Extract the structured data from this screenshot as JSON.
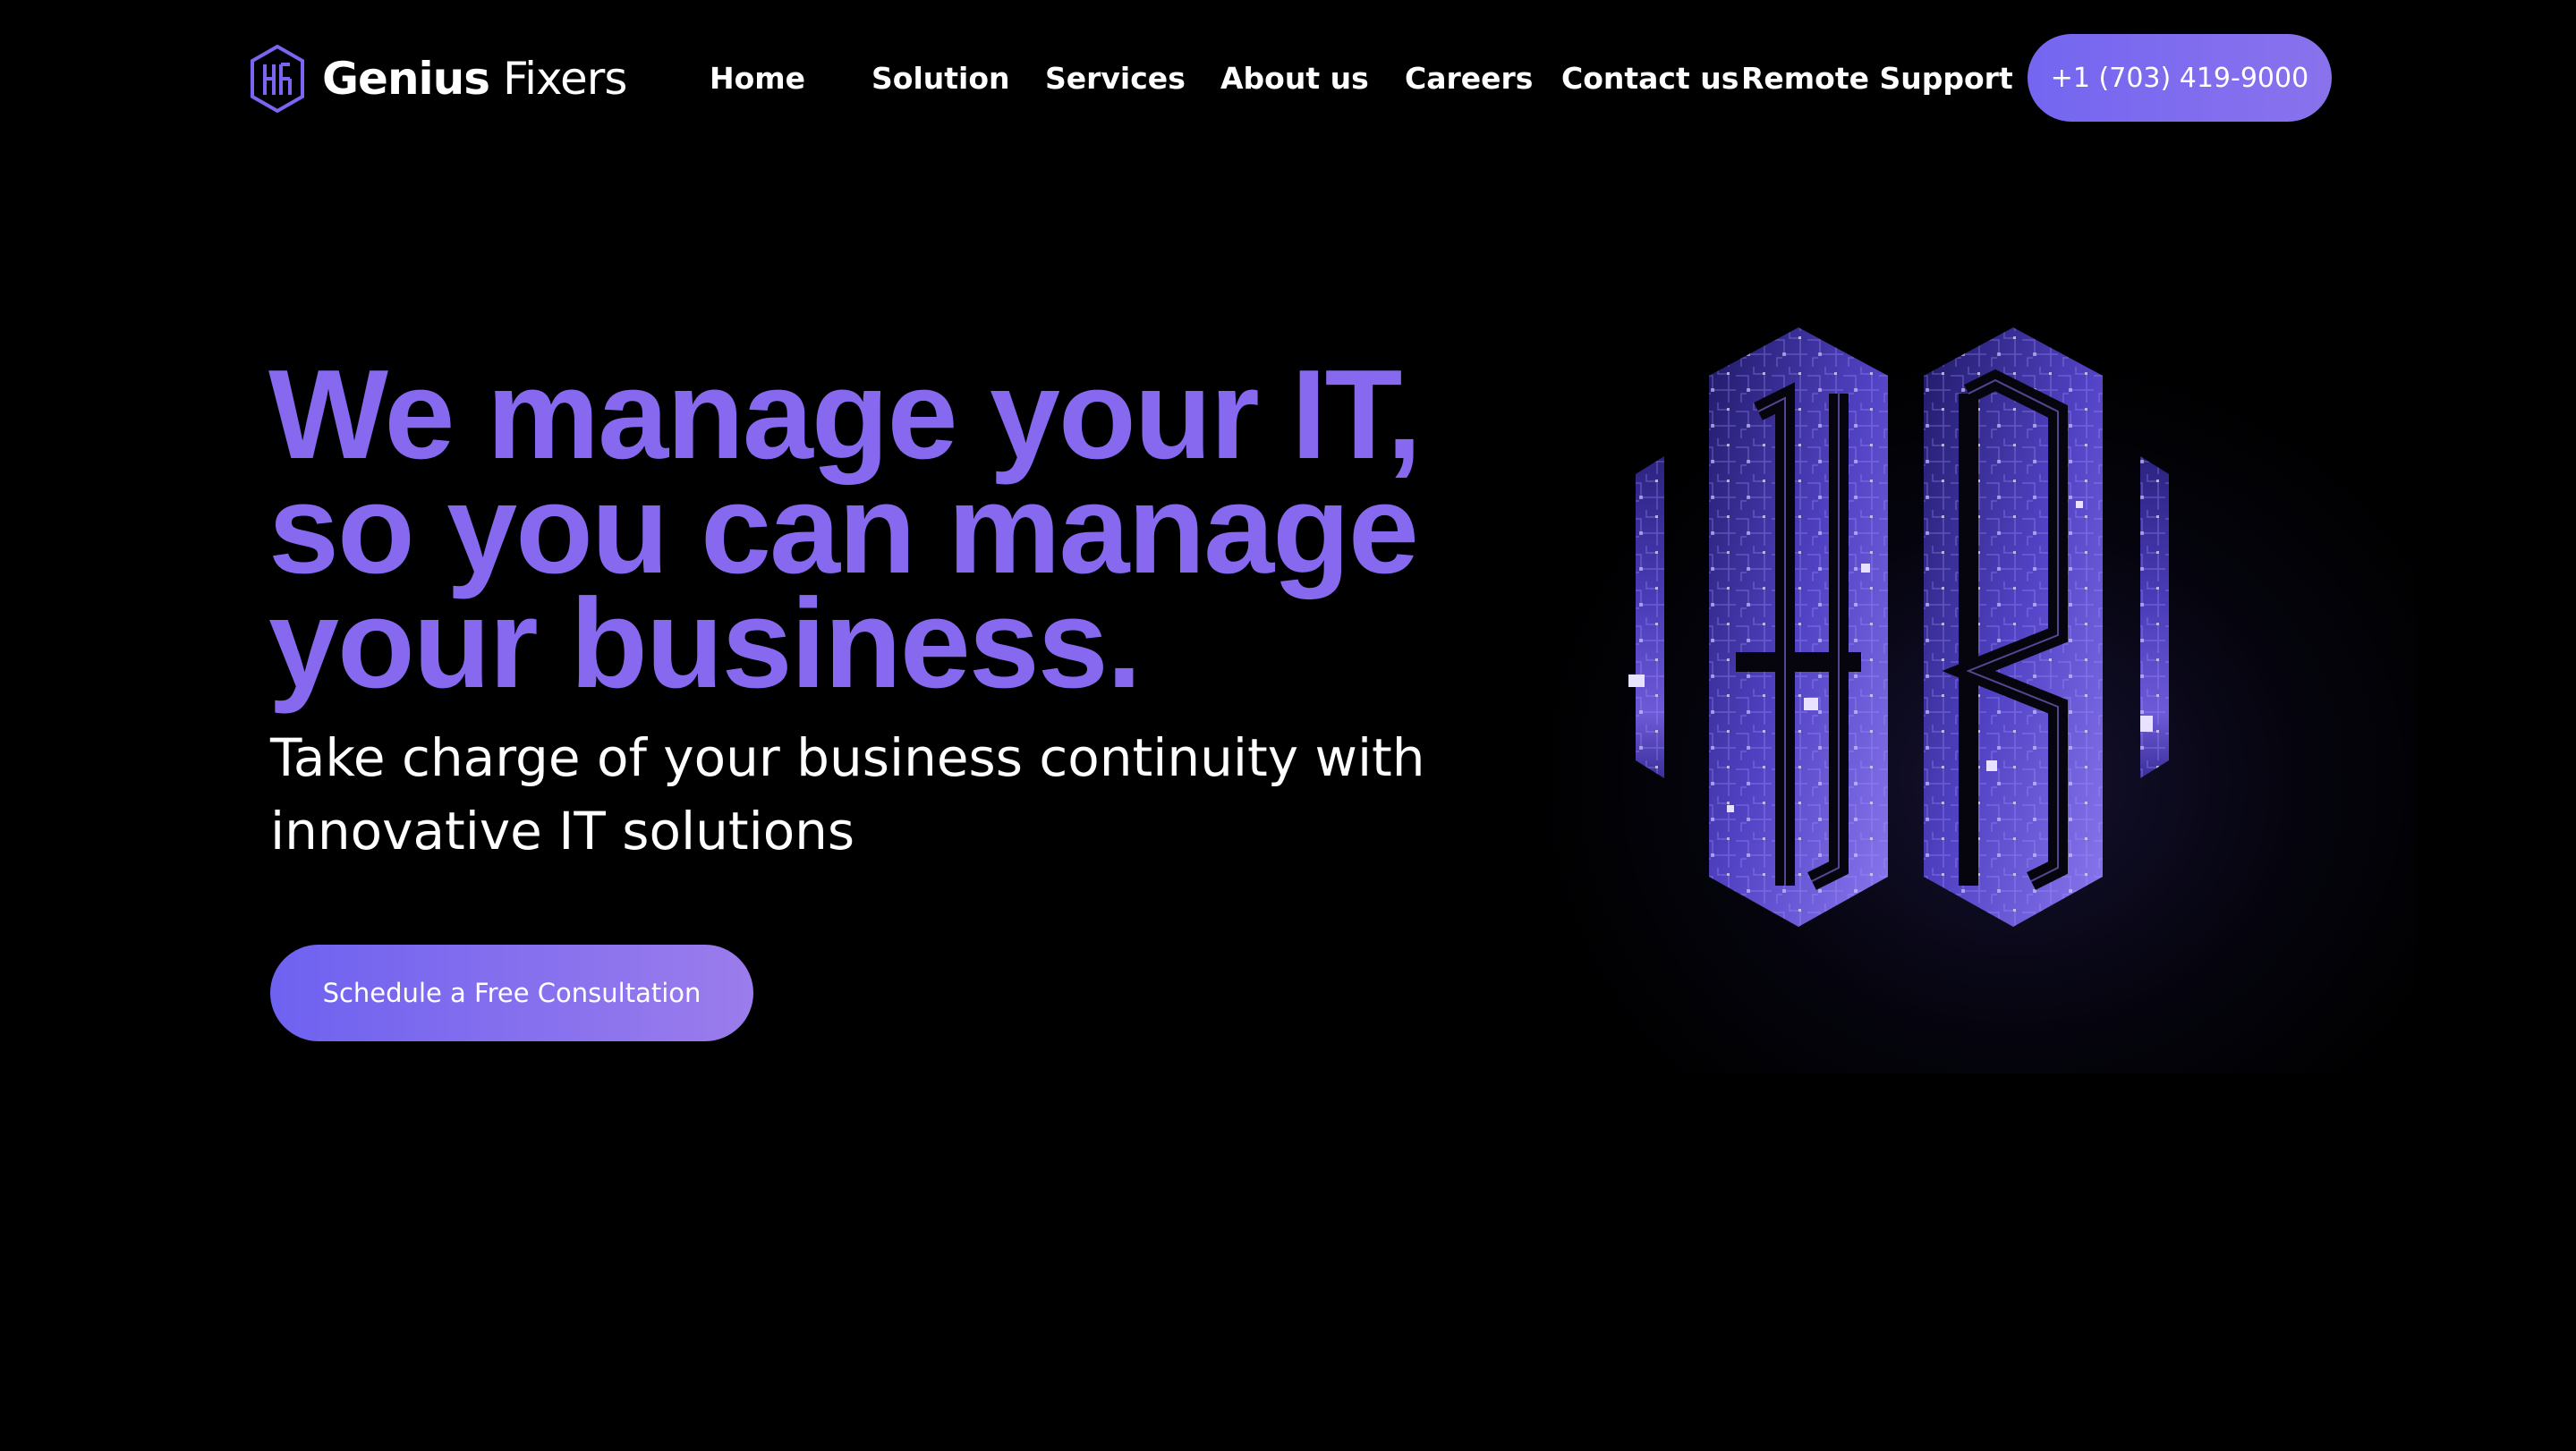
{
  "brand": {
    "name_bold": "Genius",
    "name_light": "Fixers",
    "logo_icon": "gf-monogram-icon"
  },
  "nav": {
    "items": [
      {
        "label": "Home"
      },
      {
        "label": "Solution"
      },
      {
        "label": "Services"
      },
      {
        "label": "About us"
      },
      {
        "label": "Careers"
      },
      {
        "label": "Contact us"
      },
      {
        "label": "Remote Support"
      }
    ],
    "phone_button": "+1 (703) 419-9000"
  },
  "hero": {
    "title_lines": [
      "We manage your IT,",
      "so you can manage",
      "your business."
    ],
    "subtitle_lines": [
      "Take charge of your business continuity with",
      "innovative IT solutions"
    ],
    "cta_label": "Schedule a Free Consultation",
    "emblem_icon": "circuit-monogram-emblem"
  },
  "colors": {
    "background": "#000000",
    "accent": "#8669EE",
    "button_start": "#6E62F0",
    "button_end": "#9B7CEC",
    "text": "#FFFFFF"
  }
}
